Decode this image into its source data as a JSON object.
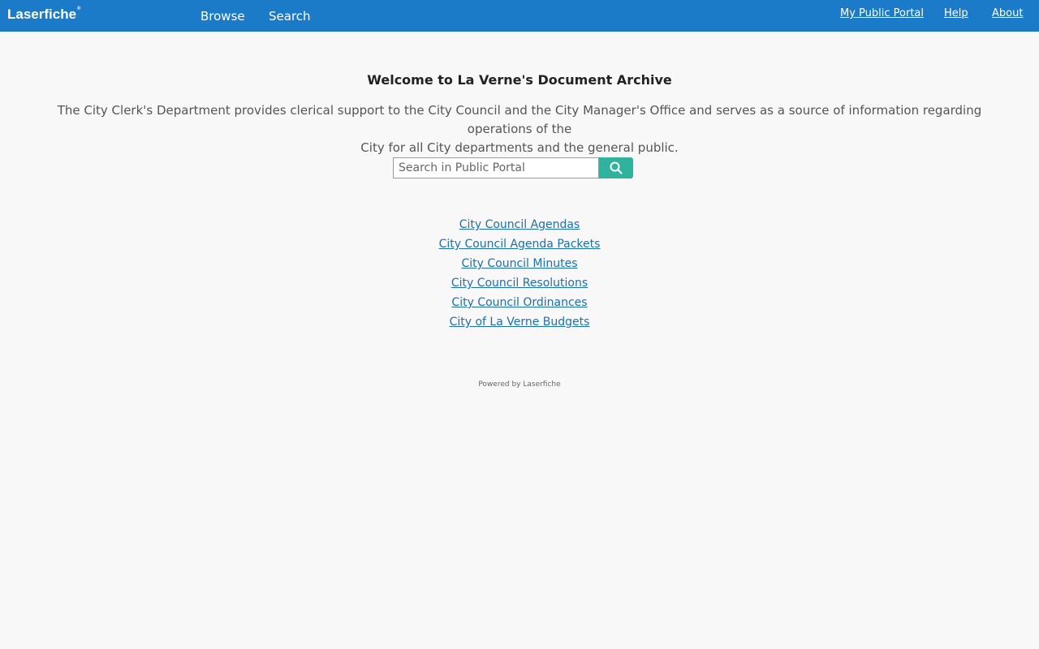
{
  "header": {
    "logo_text": "Laserfiche",
    "logo_mark": "®",
    "nav_left": [
      "Browse",
      "Search"
    ],
    "nav_right": [
      "My Public Portal",
      "Help",
      "About"
    ]
  },
  "main": {
    "welcome_title": "Welcome to La Verne's Document Archive",
    "description_line1": "The City Clerk's Department provides clerical support to the City Council and the City Manager's Office and serves as a source of information regarding operations of the",
    "description_line2": "City for all City departments and the general public.",
    "search": {
      "placeholder": "Search in Public Portal",
      "value": ""
    },
    "links": [
      "City Council Agendas",
      "City Council Agenda Packets",
      "City Council Minutes",
      "City Council Resolutions",
      "City Council Ordinances",
      "City of La Verne Budgets"
    ]
  },
  "footer": {
    "text": "Powered by Laserfiche"
  },
  "colors": {
    "header_bg": "#1b7bc8",
    "search_button": "#2fb39c",
    "link": "#1b6fb5",
    "page_bg": "#f8f8f8"
  },
  "icons": {
    "search_button_icon": "search-icon"
  }
}
